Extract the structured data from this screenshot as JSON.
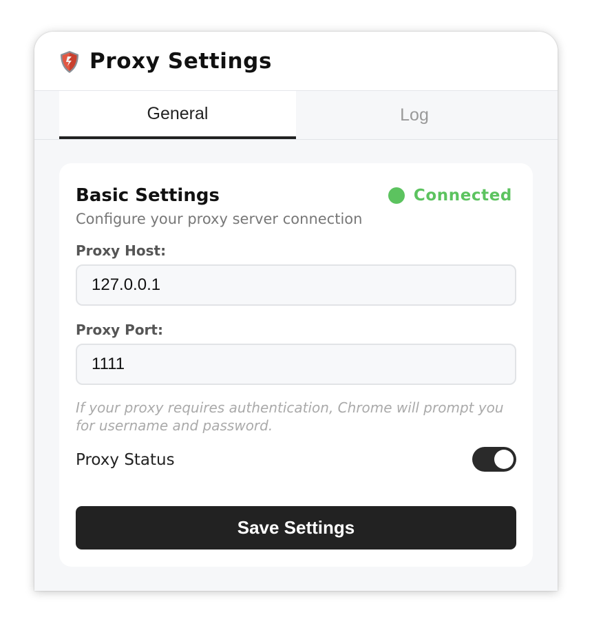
{
  "header": {
    "title": "Proxy Settings",
    "logo_icon": "shield-icon"
  },
  "tabs": [
    {
      "label": "General",
      "active": true
    },
    {
      "label": "Log",
      "active": false
    }
  ],
  "basic_settings": {
    "title": "Basic Settings",
    "subtitle": "Configure your proxy server connection",
    "status": {
      "text": "Connected",
      "color": "#5cc35f"
    },
    "host": {
      "label": "Proxy Host:",
      "value": "127.0.0.1"
    },
    "port": {
      "label": "Proxy Port:",
      "value": "1111"
    },
    "auth_hint": "If your proxy requires authentication, Chrome will prompt you for username and password.",
    "proxy_status": {
      "label": "Proxy Status",
      "enabled": true
    },
    "save_label": "Save Settings"
  },
  "colors": {
    "accent_dark": "#222222",
    "connected_green": "#5cc35f"
  }
}
